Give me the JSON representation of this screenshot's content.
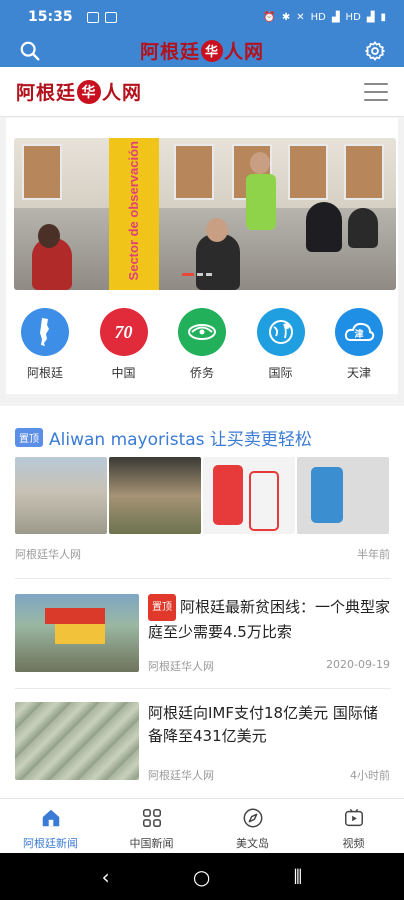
{
  "status_bar": {
    "time": "15:35",
    "network_labels": [
      "HD",
      "HD"
    ]
  },
  "header": {
    "logo_text_left": "阿根廷",
    "logo_seal": "华",
    "logo_text_right": "人网"
  },
  "brand_bar": {
    "logo_text_left": "阿根廷",
    "logo_seal": "华",
    "logo_text_right": "人网"
  },
  "banner": {
    "sign_text": "Sector de observación",
    "active_slide": 1,
    "slide_count": 3
  },
  "categories": [
    {
      "label": "阿根廷",
      "icon": "argentina-map-icon",
      "color": "#3d8ee6"
    },
    {
      "label": "中国",
      "icon": "china-70-icon",
      "color": "#e22b3a"
    },
    {
      "label": "侨务",
      "icon": "overseas-chinese-icon",
      "color": "#22b05a"
    },
    {
      "label": "国际",
      "icon": "globe-pin-icon",
      "color": "#1f9ee0"
    },
    {
      "label": "天津",
      "icon": "tianjin-cloud-icon",
      "color": "#1f8fe6"
    }
  ],
  "featured": {
    "tag": "置顶",
    "title": "Aliwan mayoristas 让买卖更轻松",
    "source": "阿根廷华人网",
    "time": "半年前"
  },
  "articles": [
    {
      "tag": "置顶",
      "title": "阿根廷最新贫困线：一个典型家庭至少需要4.5万比索",
      "source": "阿根廷华人网",
      "time": "2020-09-19"
    },
    {
      "tag": "",
      "title": "阿根廷向IMF支付18亿美元 国际储备降至431亿美元",
      "source": "阿根廷华人网",
      "time": "4小时前"
    }
  ],
  "bottom_nav": [
    {
      "label": "阿根廷新闻",
      "icon": "home-icon",
      "active": true
    },
    {
      "label": "中国新闻",
      "icon": "grid-icon",
      "active": false
    },
    {
      "label": "美文岛",
      "icon": "compass-icon",
      "active": false
    },
    {
      "label": "视频",
      "icon": "video-icon",
      "active": false
    }
  ],
  "colors": {
    "primary": "#3f86d2",
    "brand_red": "#b3121c",
    "link_blue": "#3a7bd5"
  }
}
